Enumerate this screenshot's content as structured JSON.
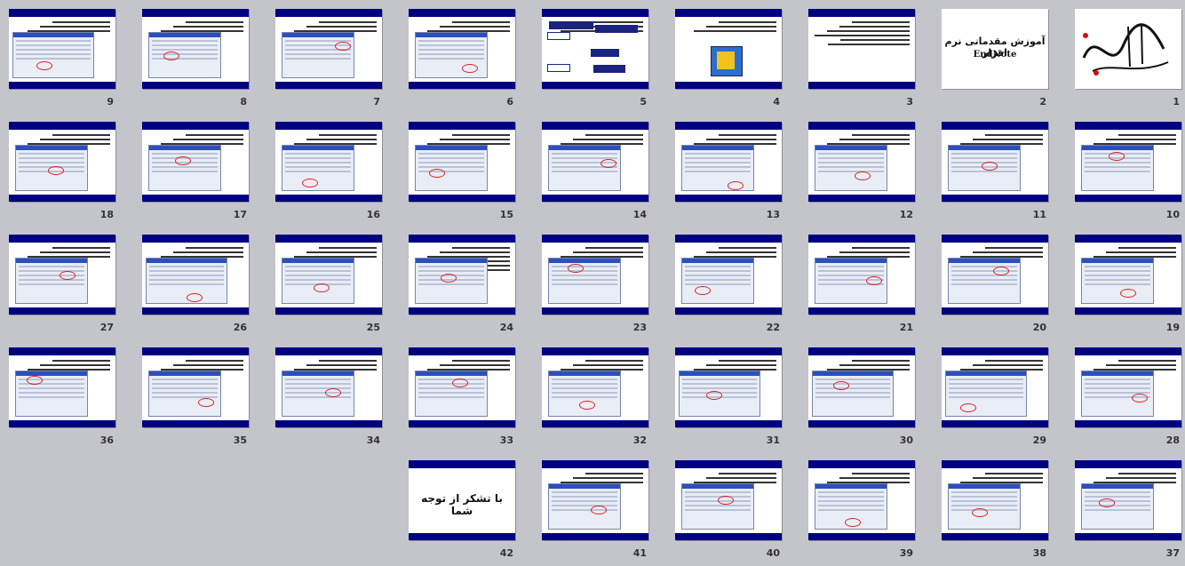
{
  "title_slide_text": "آموزش مقدماتی نرم افزار",
  "title_slide_sub": "EndNote",
  "end_slide_text": "با تشکر از توجه شما",
  "rows": [
    {
      "slides": [
        {
          "n": "9"
        },
        {
          "n": "8"
        },
        {
          "n": "7"
        },
        {
          "n": "6"
        },
        {
          "n": "5"
        },
        {
          "n": "4"
        },
        {
          "n": "3"
        },
        {
          "n": "2"
        },
        {
          "n": "1"
        }
      ]
    },
    {
      "slides": [
        {
          "n": "18"
        },
        {
          "n": "17"
        },
        {
          "n": "16"
        },
        {
          "n": "15"
        },
        {
          "n": "14"
        },
        {
          "n": "13"
        },
        {
          "n": "12"
        },
        {
          "n": "11"
        },
        {
          "n": "10"
        }
      ]
    },
    {
      "slides": [
        {
          "n": "27"
        },
        {
          "n": "26"
        },
        {
          "n": "25"
        },
        {
          "n": "24"
        },
        {
          "n": "23"
        },
        {
          "n": "22"
        },
        {
          "n": "21"
        },
        {
          "n": "20"
        },
        {
          "n": "19"
        }
      ]
    },
    {
      "slides": [
        {
          "n": "36"
        },
        {
          "n": "35"
        },
        {
          "n": "34"
        },
        {
          "n": "33"
        },
        {
          "n": "32"
        },
        {
          "n": "31"
        },
        {
          "n": "30"
        },
        {
          "n": "29"
        },
        {
          "n": "28"
        }
      ]
    },
    {
      "slides": [
        {
          "n": "42"
        },
        {
          "n": "41"
        },
        {
          "n": "40"
        },
        {
          "n": "39"
        },
        {
          "n": "38"
        },
        {
          "n": "37"
        }
      ]
    }
  ],
  "colors": {
    "background": "#c4c5cb",
    "slide_header": "#000080",
    "annotation": "#e02020"
  }
}
